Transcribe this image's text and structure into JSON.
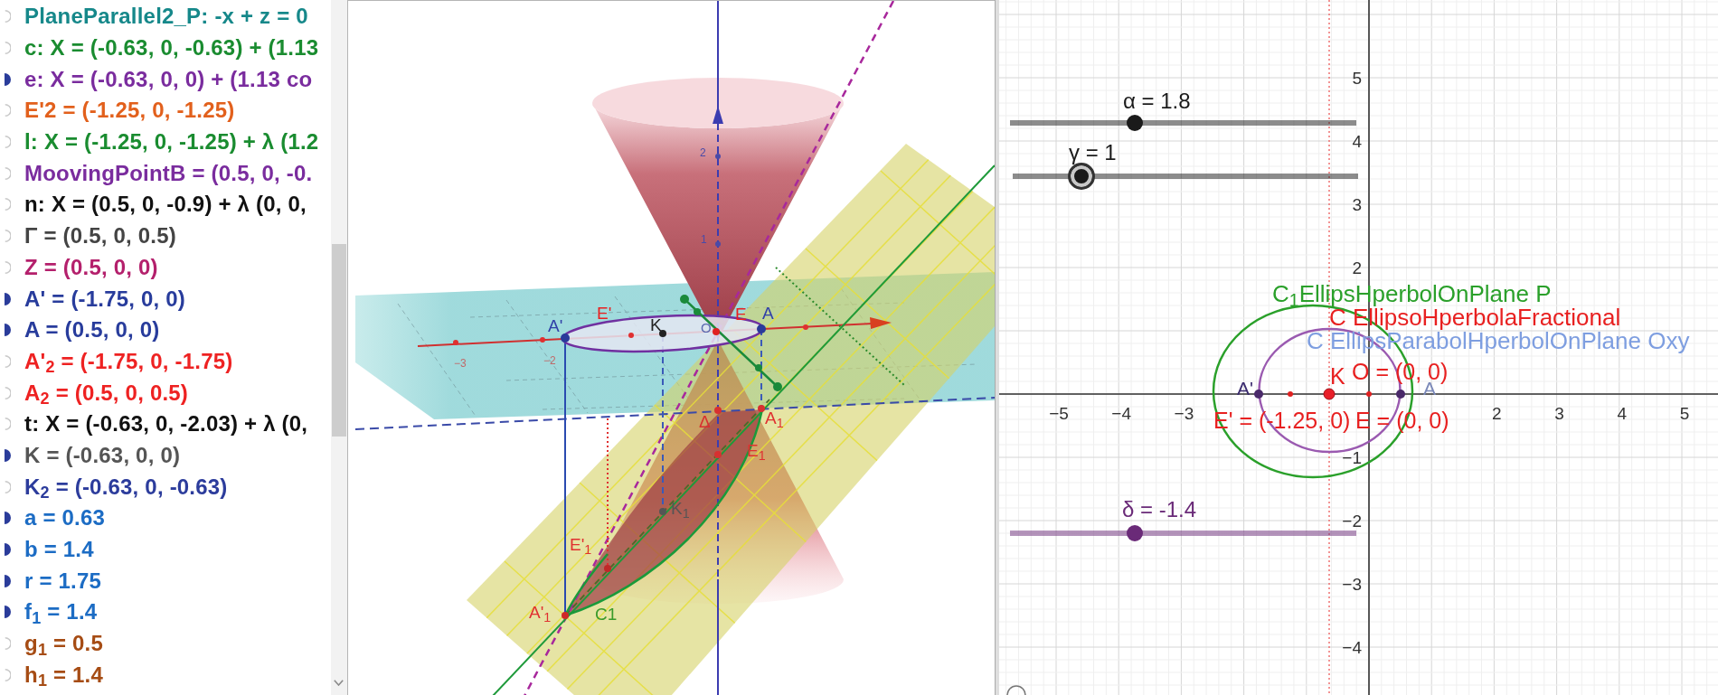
{
  "algebra_view": {
    "items": [
      {
        "text": "PlaneParallel2_P: -x + z = 0",
        "color": "#16888a",
        "visible": false
      },
      {
        "text": "c: X = (-0.63, 0, -0.63) + (1.13",
        "color": "#1a8c30",
        "visible": false
      },
      {
        "text": "e: X = (-0.63, 0, 0) + (1.13 co",
        "color": "#7a2c9e",
        "visible": true
      },
      {
        "text": "E'2 = (-1.25, 0, -1.25)",
        "color": "#e2601c",
        "visible": false
      },
      {
        "text": "l: X = (-1.25, 0, -1.25) + λ (1.2",
        "color": "#1a8c30",
        "visible": false
      },
      {
        "text": "MoovingPointB = (0.5, 0, -0.",
        "color": "#7a2c9e",
        "visible": false
      },
      {
        "text": "n: X = (0.5, 0, -0.9) + λ (0, 0,",
        "color": "#111111",
        "visible": false
      },
      {
        "text": "Γ = (0.5, 0, 0.5)",
        "color": "#444444",
        "visible": false
      },
      {
        "text": "Z = (0.5, 0, 0)",
        "color": "#b4206c",
        "visible": false
      },
      {
        "text": "A' = (-1.75, 0, 0)",
        "color": "#283c9c",
        "visible": true
      },
      {
        "text": "A = (0.5, 0, 0)",
        "color": "#283c9c",
        "visible": true
      },
      {
        "text": "A'$_{2}$ = (-1.75, 0, -1.75)",
        "color": "#ee2222",
        "visible": false
      },
      {
        "text": "A$_{2}$ = (0.5, 0, 0.5)",
        "color": "#ee2222",
        "visible": false
      },
      {
        "text": "t: X = (-0.63, 0, -2.03) + λ (0,",
        "color": "#111111",
        "visible": false
      },
      {
        "text": "K = (-0.63, 0, 0)",
        "color": "#555555",
        "visible": true
      },
      {
        "text": "K$_{2}$ = (-0.63, 0, -0.63)",
        "color": "#2c3c9c",
        "visible": false
      },
      {
        "text": "a = 0.63",
        "color": "#1c6cc4",
        "visible": true
      },
      {
        "text": "b = 1.4",
        "color": "#1c6cc4",
        "visible": true
      },
      {
        "text": "r = 1.75",
        "color": "#1c6cc4",
        "visible": true
      },
      {
        "text": "f$_{1}$ = 1.4",
        "color": "#1c6cc4",
        "visible": true
      },
      {
        "text": "g$_{1}$ = 0.5",
        "color": "#a64c14",
        "visible": false
      },
      {
        "text": "h$_{1}$ = 1.4",
        "color": "#a64c14",
        "visible": false
      }
    ]
  },
  "graphics_3d": {
    "axis_labels": [
      {
        "text": "2",
        "color": "#4a4aa8"
      },
      {
        "text": "1",
        "color": "#4a4aa8"
      },
      {
        "text": "−3",
        "color": "#c06a6a"
      },
      {
        "text": "−2",
        "color": "#c06a6a"
      }
    ],
    "point_labels": [
      {
        "text": "E'",
        "color": "#e82020"
      },
      {
        "text": "A'",
        "color": "#3040a8"
      },
      {
        "text": "K",
        "color": "#222222"
      },
      {
        "text": "O",
        "color": "#5a6ab0"
      },
      {
        "text": "E",
        "color": "#e82020"
      },
      {
        "text": "A",
        "color": "#3040a8"
      },
      {
        "text": "Δ",
        "color": "#d83030"
      },
      {
        "text": "A$_{1}$",
        "color": "#e03030"
      },
      {
        "text": "E$_{1}$",
        "color": "#e03030"
      },
      {
        "text": "K$_{1}$",
        "color": "#555555"
      },
      {
        "text": "E'$_{1}$",
        "color": "#e03030"
      },
      {
        "text": "A'$_{1}$",
        "color": "#e03030"
      },
      {
        "text": "C1",
        "color": "#3a9a2a"
      }
    ]
  },
  "graphics_2d": {
    "sliders": [
      {
        "label": "α = 1.8",
        "level": 0.36,
        "color": "#1a1a1a",
        "selected": false
      },
      {
        "label": "γ = 1",
        "level": 0.2,
        "color": "#1a1a1a",
        "selected": true
      },
      {
        "label": "δ = -1.4",
        "level": 0.36,
        "color": "#6a2a78",
        "selected": false
      }
    ],
    "x_axis_labels": [
      "−5",
      "−4",
      "−3",
      "2",
      "3",
      "4",
      "5"
    ],
    "y_axis_labels": [
      "5",
      "4",
      "3",
      "2",
      "−1",
      "−2",
      "−3",
      "−4"
    ],
    "curve_labels": [
      {
        "text": "C$_{1}$EllipsHperbolOnPlane P",
        "color": "#2aa02a"
      },
      {
        "text": "C EllipsoHperbolaFractional",
        "color": "#e82020"
      },
      {
        "text": "C EllipsParabolHperbolOnPlane Oxy",
        "color": "#7e9ee0"
      }
    ],
    "point_labels": [
      {
        "text": "A'",
        "color": "#3a2a6e"
      },
      {
        "text": "K",
        "color": "#e82020"
      },
      {
        "text": "O = (0, 0)",
        "color": "#e82020"
      },
      {
        "text": "A",
        "color": "#7a88b8"
      },
      {
        "text": "E' = (-1.25, 0)",
        "color": "#e82020"
      },
      {
        "text": "E = (0, 0)",
        "color": "#e82020"
      }
    ]
  }
}
